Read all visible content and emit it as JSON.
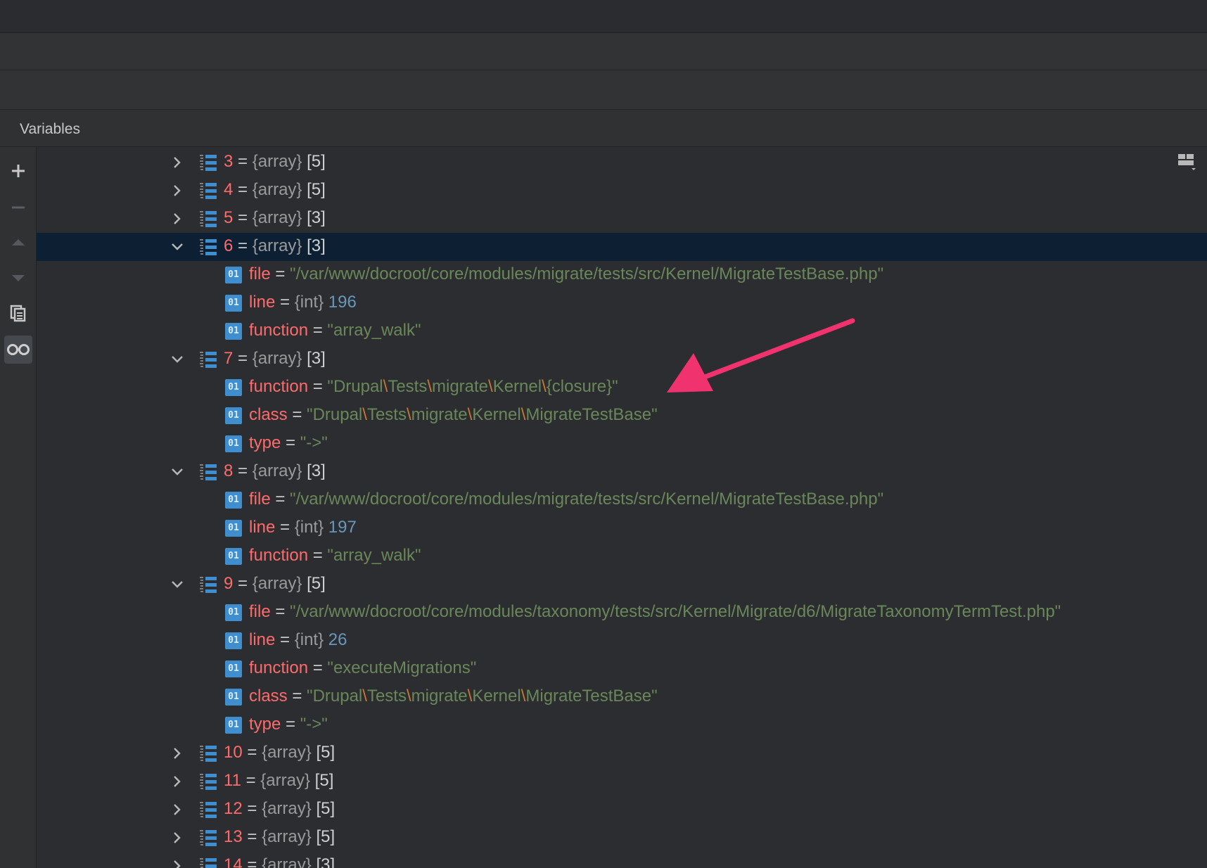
{
  "panel": {
    "tab_title": "Variables"
  },
  "toolbar": {
    "settings_icon": "gear-icon",
    "minimize_icon": "minimize-icon",
    "layout_icon": "layout-icon"
  },
  "sidebar": {
    "buttons": [
      "plus-icon",
      "minus-icon",
      "arrow-up-icon",
      "arrow-down-icon",
      "copy-icon",
      "watch-glasses-icon"
    ]
  },
  "colors": {
    "key": "#ff6b6b",
    "string": "#6a8759",
    "number": "#6897bb",
    "backslash": "#cc7832",
    "selection": "#0d2033",
    "annotation_arrow": "#f0336e"
  },
  "rows": [
    {
      "kind": "array",
      "expanded": false,
      "key": "3",
      "type": "{array}",
      "count": "[5]"
    },
    {
      "kind": "array",
      "expanded": false,
      "key": "4",
      "type": "{array}",
      "count": "[5]"
    },
    {
      "kind": "array",
      "expanded": false,
      "key": "5",
      "type": "{array}",
      "count": "[3]"
    },
    {
      "kind": "array",
      "expanded": true,
      "selected": true,
      "key": "6",
      "type": "{array}",
      "count": "[3]"
    },
    {
      "kind": "prop",
      "key": "file",
      "value": "\"/var/www/docroot/core/modules/migrate/tests/src/Kernel/MigrateTestBase.php\""
    },
    {
      "kind": "prop",
      "key": "line",
      "type": "{int}",
      "value": "196"
    },
    {
      "kind": "prop",
      "key": "function",
      "value": "\"array_walk\""
    },
    {
      "kind": "array",
      "expanded": true,
      "key": "7",
      "type": "{array}",
      "count": "[3]"
    },
    {
      "kind": "prop",
      "key": "function",
      "value": "\"Drupal\\Tests\\migrate\\Kernel\\{closure}\""
    },
    {
      "kind": "prop",
      "key": "class",
      "value": "\"Drupal\\Tests\\migrate\\Kernel\\MigrateTestBase\""
    },
    {
      "kind": "prop",
      "key": "type",
      "value": "\"->\""
    },
    {
      "kind": "array",
      "expanded": true,
      "key": "8",
      "type": "{array}",
      "count": "[3]"
    },
    {
      "kind": "prop",
      "key": "file",
      "value": "\"/var/www/docroot/core/modules/migrate/tests/src/Kernel/MigrateTestBase.php\""
    },
    {
      "kind": "prop",
      "key": "line",
      "type": "{int}",
      "value": "197"
    },
    {
      "kind": "prop",
      "key": "function",
      "value": "\"array_walk\""
    },
    {
      "kind": "array",
      "expanded": true,
      "key": "9",
      "type": "{array}",
      "count": "[5]"
    },
    {
      "kind": "prop",
      "key": "file",
      "value": "\"/var/www/docroot/core/modules/taxonomy/tests/src/Kernel/Migrate/d6/MigrateTaxonomyTermTest.php\""
    },
    {
      "kind": "prop",
      "key": "line",
      "type": "{int}",
      "value": "26"
    },
    {
      "kind": "prop",
      "key": "function",
      "value": "\"executeMigrations\""
    },
    {
      "kind": "prop",
      "key": "class",
      "value": "\"Drupal\\Tests\\migrate\\Kernel\\MigrateTestBase\""
    },
    {
      "kind": "prop",
      "key": "type",
      "value": "\"->\""
    },
    {
      "kind": "array",
      "expanded": false,
      "key": "10",
      "type": "{array}",
      "count": "[5]"
    },
    {
      "kind": "array",
      "expanded": false,
      "key": "11",
      "type": "{array}",
      "count": "[5]"
    },
    {
      "kind": "array",
      "expanded": false,
      "key": "12",
      "type": "{array}",
      "count": "[5]"
    },
    {
      "kind": "array",
      "expanded": false,
      "key": "13",
      "type": "{array}",
      "count": "[5]"
    },
    {
      "kind": "array",
      "expanded": false,
      "key": "14",
      "type": "{array}",
      "count": "[3]"
    }
  ]
}
